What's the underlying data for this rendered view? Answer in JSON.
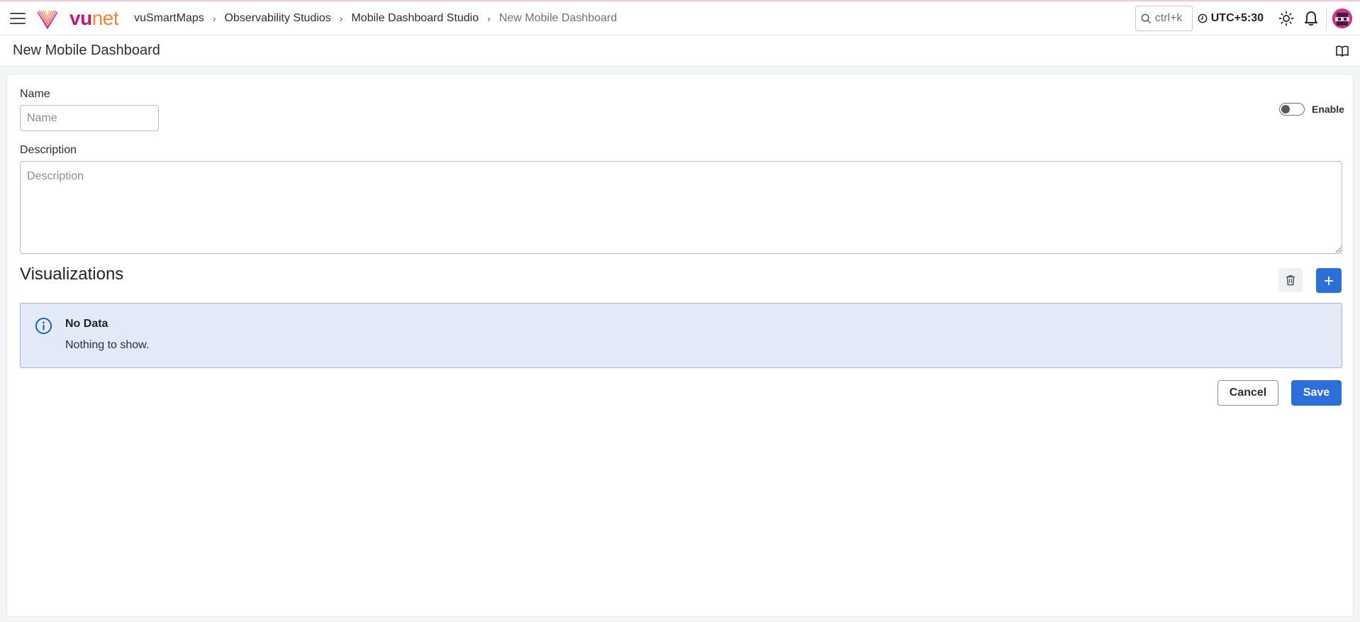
{
  "topbar": {
    "menu_icon": "hamburger-menu-icon",
    "logo": {
      "vu": "vu",
      "net": "net",
      "brand_color": "#c2187b",
      "accent_color": "#f0883a"
    },
    "breadcrumb": [
      {
        "label": "vuSmartMaps"
      },
      {
        "label": "Observability Studios"
      },
      {
        "label": "Mobile Dashboard Studio"
      },
      {
        "label": "New Mobile Dashboard"
      }
    ],
    "search": {
      "placeholder": "ctrl+k",
      "icon": "search-icon"
    },
    "timezone": "UTC+5:30",
    "icons": [
      "clock-icon",
      "sun-icon",
      "bell-icon",
      "avatar"
    ]
  },
  "page": {
    "title": "New Mobile Dashboard",
    "help_icon": "book-icon"
  },
  "form": {
    "name_label": "Name",
    "name_placeholder": "Name",
    "name_value": "",
    "description_label": "Description",
    "description_placeholder": "Description",
    "description_value": "",
    "enable_label": "Enable",
    "enabled": false
  },
  "visualizations": {
    "title": "Visualizations",
    "alert_title": "No Data",
    "alert_message": "Nothing to show.",
    "alert_color": "#e2eaf8"
  },
  "actions": {
    "cancel_label": "Cancel",
    "save_label": "Save",
    "primary_color": "#2d6fd8"
  }
}
